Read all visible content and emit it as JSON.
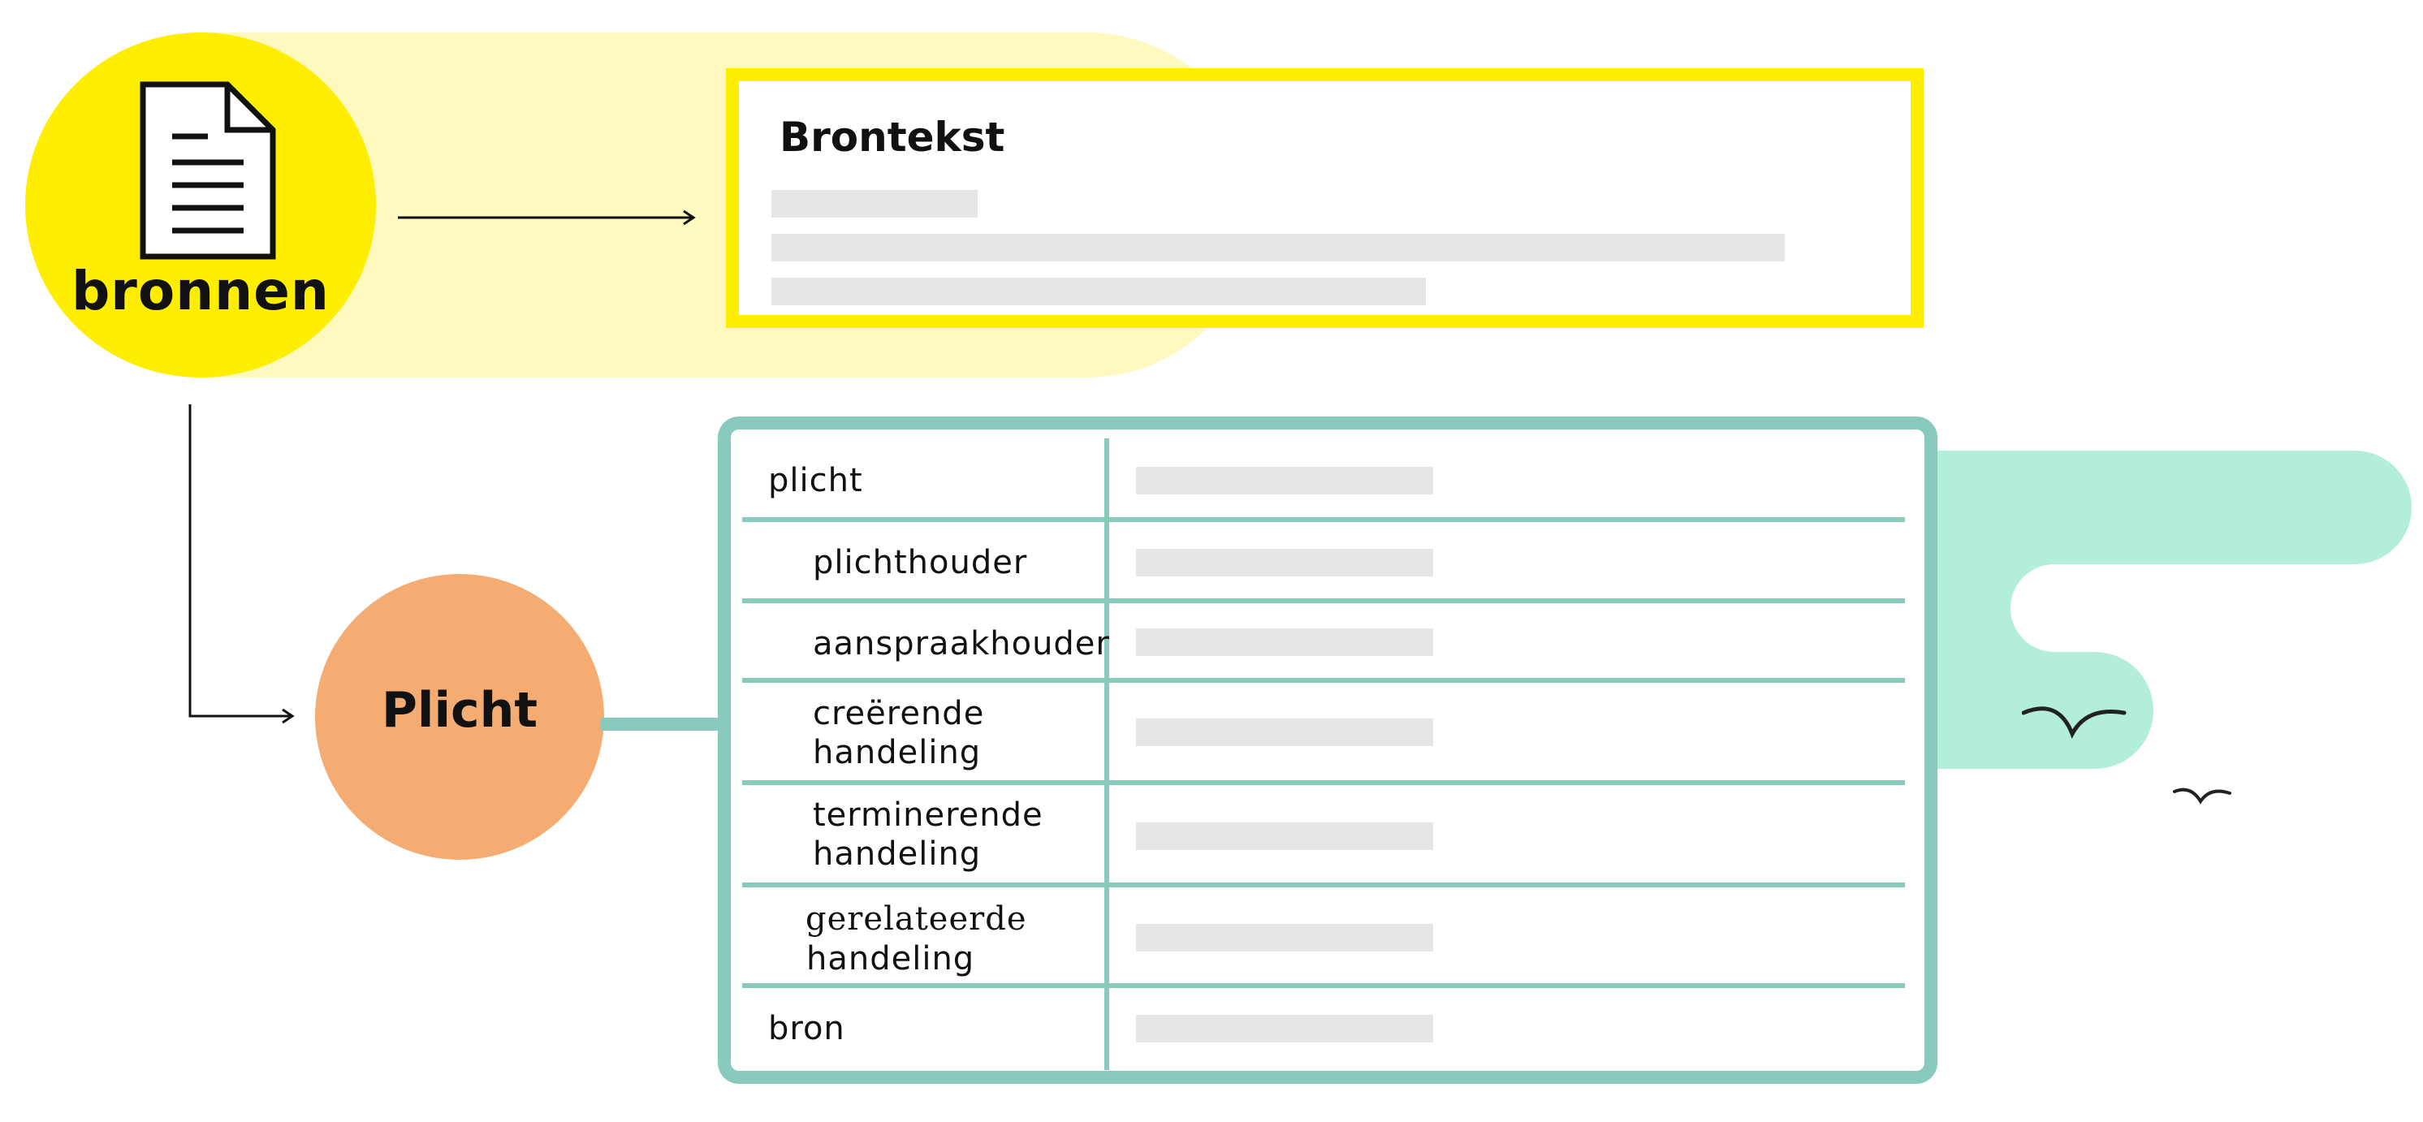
{
  "bronnen": {
    "label": "bronnen",
    "icon": "document-icon"
  },
  "brontekst": {
    "title": "Brontekst"
  },
  "plicht": {
    "label": "Plicht"
  },
  "rows": [
    {
      "label": "plicht"
    },
    {
      "label": "plichthouder"
    },
    {
      "label": "aanspraakhouder"
    },
    {
      "label_line1": "creërende",
      "label_line2": "handeling"
    },
    {
      "label_line1": "terminerende",
      "label_line2": "handeling"
    },
    {
      "label_line1": "gerelateerde",
      "label_line2": "handeling"
    },
    {
      "label": "bron"
    }
  ],
  "colors": {
    "yellow": "#ffee00",
    "yellow_light": "#fff8bf",
    "orange": "#f4ac72",
    "teal": "#88cbbd",
    "mint": "#b3eedb",
    "placeholder": "#e6e6e6"
  }
}
